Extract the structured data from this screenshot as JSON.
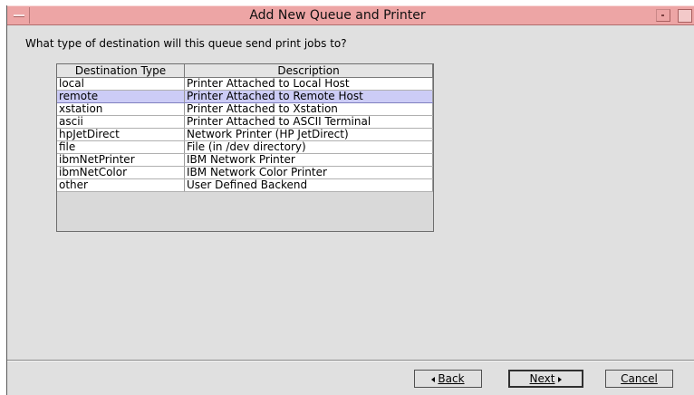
{
  "window": {
    "title": "Add New Queue and Printer"
  },
  "prompt": "What type of destination will this queue send print jobs to?",
  "table": {
    "headers": [
      "Destination Type",
      "Description"
    ],
    "selected_index": 1,
    "rows": [
      {
        "type": "local",
        "description": "Printer Attached to Local Host"
      },
      {
        "type": "remote",
        "description": "Printer Attached to Remote Host"
      },
      {
        "type": "xstation",
        "description": "Printer Attached to Xstation"
      },
      {
        "type": "ascii",
        "description": "Printer Attached to ASCII Terminal"
      },
      {
        "type": "hpJetDirect",
        "description": "Network Printer (HP JetDirect)"
      },
      {
        "type": "file",
        "description": "File (in /dev directory)"
      },
      {
        "type": "ibmNetPrinter",
        "description": "IBM Network Printer"
      },
      {
        "type": "ibmNetColor",
        "description": "IBM Network Color Printer"
      },
      {
        "type": "other",
        "description": "User Defined Backend"
      }
    ]
  },
  "buttons": {
    "back": "Back",
    "next": "Next",
    "cancel": "Cancel"
  },
  "colors": {
    "titlebar": "#eda5a5",
    "window_bg": "#e0e0e0",
    "selection": "#ccccf6"
  },
  "icons": {
    "window_menu": "window-menu-icon",
    "minimize": "minimize-icon",
    "maximize": "maximize-icon",
    "back_arrow": "triangle-left-icon",
    "next_arrow": "triangle-right-icon"
  }
}
